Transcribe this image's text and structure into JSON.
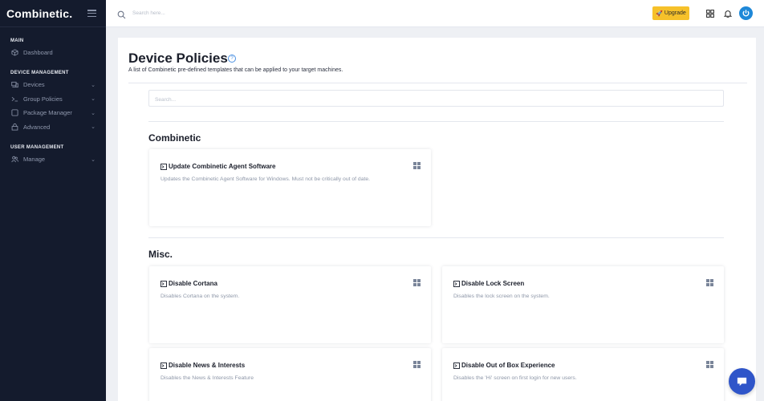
{
  "brand": "Combinetic.",
  "sidebar": {
    "sections": [
      {
        "label": "MAIN",
        "items": [
          {
            "label": "Dashboard",
            "icon": "dashboard-icon",
            "has_chevron": false
          }
        ]
      },
      {
        "label": "DEVICE MANAGEMENT",
        "items": [
          {
            "label": "Devices",
            "icon": "devices-icon",
            "has_chevron": true
          },
          {
            "label": "Group Policies",
            "icon": "terminal-icon",
            "has_chevron": true
          },
          {
            "label": "Package Manager",
            "icon": "package-icon",
            "has_chevron": true
          },
          {
            "label": "Advanced",
            "icon": "advanced-icon",
            "has_chevron": true
          }
        ]
      },
      {
        "label": "USER MANAGEMENT",
        "items": [
          {
            "label": "Manage",
            "icon": "users-icon",
            "has_chevron": true
          }
        ]
      }
    ]
  },
  "topbar": {
    "search_placeholder": "Search here...",
    "upgrade_label": "Upgrade"
  },
  "page": {
    "title": "Device Policies",
    "subtitle": "A list of Combinetic pre-defined templates that can be applied to your target machines.",
    "search_placeholder": "Search..."
  },
  "sections": [
    {
      "title": "Combinetic",
      "cards": [
        {
          "title": "Update Combinetic Agent Software",
          "description": "Updates the Combinetic Agent Software for Windows. Must not be critically out of date.",
          "os": "windows-icon"
        }
      ]
    },
    {
      "title": "Misc.",
      "cards": [
        {
          "title": "Disable Cortana",
          "description": "Disables Cortana on the system.",
          "os": "windows-icon"
        },
        {
          "title": "Disable Lock Screen",
          "description": "Disables the lock screen on the system.",
          "os": "windows-icon"
        },
        {
          "title": "Disable News & Interests",
          "description": "Disables the News & Interests Feature",
          "os": "windows-icon"
        },
        {
          "title": "Disable Out of Box Experience",
          "description": "Disables the 'Hi' screen on first login for new users.",
          "os": "windows-icon"
        }
      ]
    }
  ],
  "colors": {
    "sidebar_bg": "#141b2d",
    "accent": "#1e88d8",
    "upgrade": "#f6c12a",
    "chat": "#2f55c9"
  }
}
